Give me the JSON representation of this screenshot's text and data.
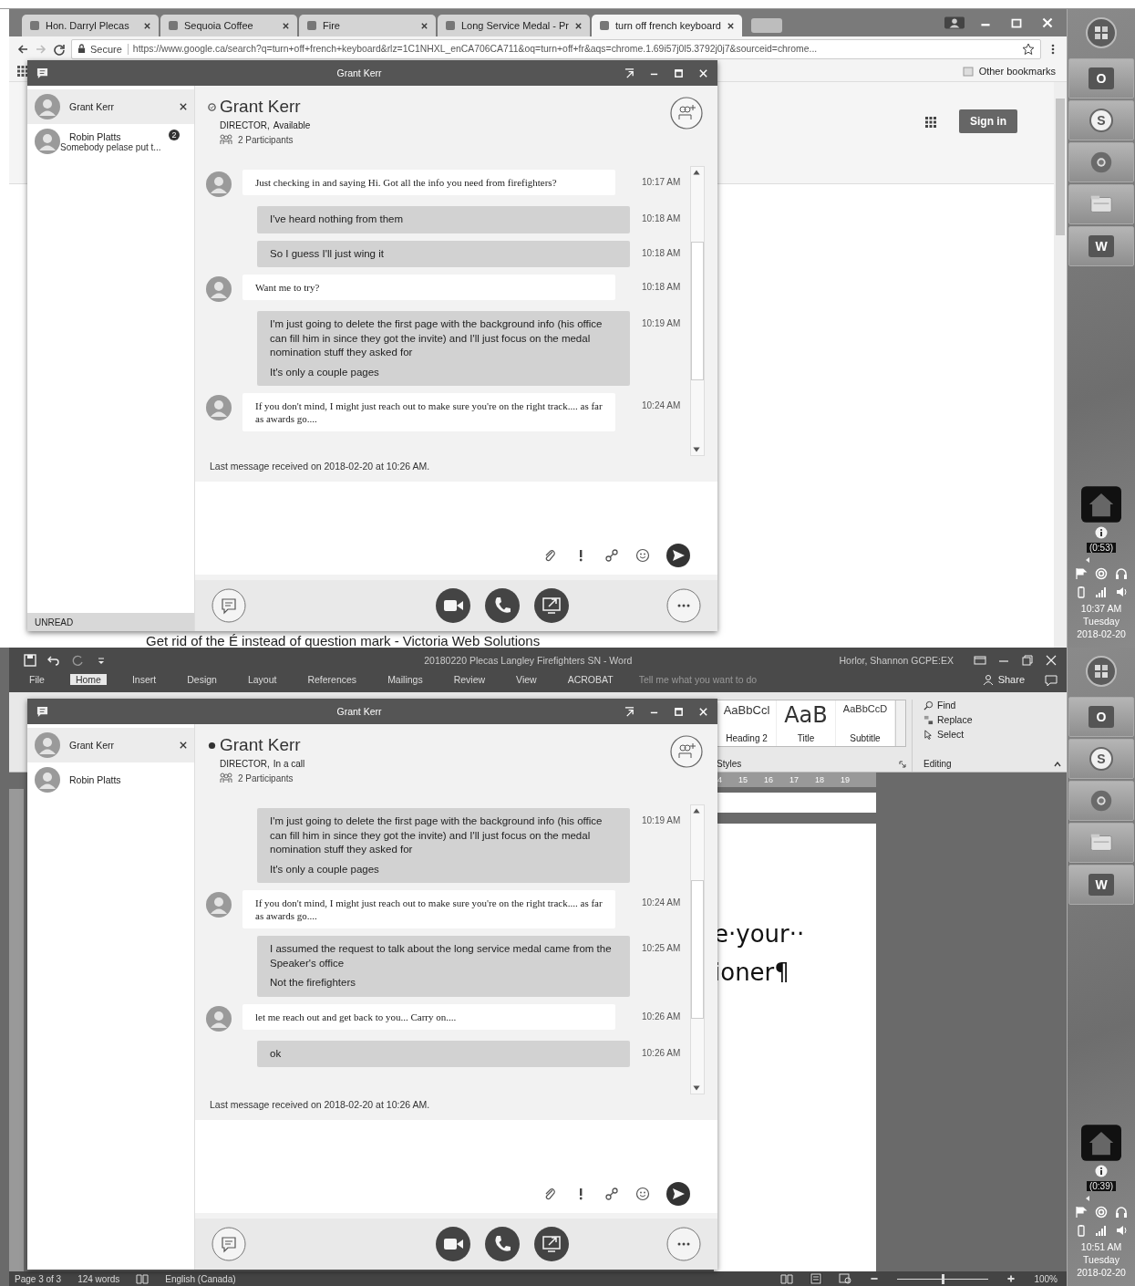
{
  "panels": [
    {
      "kind": "browser",
      "tabs": [
        {
          "label": "Hon. Darryl Plecas",
          "selected": false
        },
        {
          "label": "Sequoia Coffee",
          "selected": false
        },
        {
          "label": "Fire",
          "selected": false
        },
        {
          "label": "Long Service Medal - Pr",
          "selected": false
        },
        {
          "label": "turn off french keyboard",
          "selected": true
        }
      ],
      "address": {
        "secure": "Secure",
        "url": "https://www.google.ca/search?q=turn+off+french+keyboard&rlz=1C1NHXL_enCA706CA711&oq=turn+off+fr&aqs=chrome.1.69i57j0l5.3792j0j7&sourceid=chrome..."
      },
      "bookmark": "Other bookmarks",
      "sign_in": "Sign in",
      "result_title": "Get rid of the É instead of question mark - Victoria Web Solutions",
      "chat": {
        "title": "Grant Kerr",
        "conversations": [
          {
            "name": "Grant Kerr",
            "selected": true
          },
          {
            "name": "Robin Platts",
            "preview": "Somebody pelase put t...",
            "badge": "2",
            "selected": false
          }
        ],
        "unread_label": "UNREAD",
        "header": {
          "name": "Grant Kerr",
          "available": true,
          "role": "DIRECTOR,",
          "status": "Available",
          "participants": "2 Participants"
        },
        "messages": [
          {
            "kind": "them",
            "paragraphs": [
              "Just checking in and saying Hi. Got all the info you need from firefighters?"
            ],
            "time": "10:17 AM"
          },
          {
            "kind": "me",
            "paragraphs": [
              "I've heard nothing from them"
            ],
            "time": "10:18 AM"
          },
          {
            "kind": "me",
            "paragraphs": [
              "So I guess I'll just wing it"
            ],
            "time": "10:18 AM"
          },
          {
            "kind": "them",
            "paragraphs": [
              "Want me to try?"
            ],
            "time": "10:18 AM"
          },
          {
            "kind": "me",
            "paragraphs": [
              "I'm just going to delete the first page with the background info (his office can fill him in since they got the invite) and I'll just focus on the medal nomination stuff they asked for",
              "It's only a couple pages"
            ],
            "time": "10:19 AM"
          },
          {
            "kind": "them",
            "paragraphs": [
              "If you don't mind, I might just reach out to make sure you're on the right track.... as far as awards go...."
            ],
            "time": "10:24 AM"
          }
        ],
        "footer": "Last message received on 2018-02-20 at 10:26 AM."
      },
      "taskbar": {
        "apps": [
          {
            "kind": "mail",
            "letter": "O"
          },
          {
            "kind": "chat",
            "letter": "S"
          },
          {
            "kind": "browser"
          },
          {
            "kind": "files"
          },
          {
            "kind": "doc",
            "letter": "W"
          }
        ],
        "timer": "(0:53)",
        "time": "10:37 AM",
        "day": "Tuesday",
        "date": "2018-02-20"
      }
    },
    {
      "kind": "word",
      "title": "20180220 Plecas Langley Firefighters SN  -  Word",
      "account": "Horlor, Shannon GCPE:EX",
      "ribbon_tabs": [
        {
          "label": "File",
          "selected": false
        },
        {
          "label": "Home",
          "selected": true
        },
        {
          "label": "Insert",
          "selected": false
        },
        {
          "label": "Design",
          "selected": false
        },
        {
          "label": "Layout",
          "selected": false
        },
        {
          "label": "References",
          "selected": false
        },
        {
          "label": "Mailings",
          "selected": false
        },
        {
          "label": "Review",
          "selected": false
        },
        {
          "label": "View",
          "selected": false
        },
        {
          "label": "ACROBAT",
          "selected": false
        }
      ],
      "tell_me": "Tell me what you want to do",
      "share": "Share",
      "styles": [
        {
          "preview": "AaBbCcl",
          "name": "Heading 2",
          "kind": "heading"
        },
        {
          "preview": "AaB",
          "name": "Title",
          "kind": "title"
        },
        {
          "preview": "AaBbCcD",
          "name": "Subtitle",
          "kind": "subtitle"
        }
      ],
      "styles_label": "Styles",
      "editing": [
        "Find",
        "Replace",
        "Select"
      ],
      "editing_label": "Editing",
      "ruler": [
        "4",
        "15",
        "16",
        "17",
        "18",
        "19"
      ],
      "document_lines": [
        "e·your··",
        "ioner¶"
      ],
      "status": {
        "page": "Page 3 of 3",
        "words": "124 words",
        "language": "English (Canada)",
        "zoom": "100%"
      },
      "zoom_slider": {
        "level": 0.5
      },
      "chat": {
        "title": "Grant Kerr",
        "conversations": [
          {
            "name": "Grant Kerr",
            "selected": true
          },
          {
            "name": "Robin Platts",
            "selected": false
          }
        ],
        "header": {
          "name": "Grant Kerr",
          "available": false,
          "role": "DIRECTOR,",
          "status": "In a call",
          "participants": "2 Participants"
        },
        "messages": [
          {
            "kind": "me",
            "paragraphs": [
              "I'm just going to delete the first page with the background info (his office can fill him in since they got the invite) and I'll just focus on the medal nomination stuff they asked for",
              "It's only a couple pages"
            ],
            "time": "10:19 AM"
          },
          {
            "kind": "them",
            "paragraphs": [
              "If you don't mind, I might just reach out to make sure you're on the right track.... as far as awards go...."
            ],
            "time": "10:24 AM"
          },
          {
            "kind": "me",
            "paragraphs": [
              "I assumed the request to talk about the long service medal came from the Speaker's office",
              "Not the firefighters"
            ],
            "time": "10:25 AM"
          },
          {
            "kind": "them",
            "paragraphs": [
              "let me reach out and get back to you... Carry on...."
            ],
            "time": "10:26 AM"
          },
          {
            "kind": "me",
            "paragraphs": [
              "ok"
            ],
            "time": "10:26 AM"
          }
        ],
        "footer": "Last message received on 2018-02-20 at 10:26 AM."
      },
      "taskbar": {
        "apps": [
          {
            "kind": "mail",
            "letter": "O"
          },
          {
            "kind": "chat",
            "letter": "S"
          },
          {
            "kind": "browser"
          },
          {
            "kind": "files"
          },
          {
            "kind": "doc",
            "letter": "W"
          }
        ],
        "timer": "(0:39)",
        "time": "10:51 AM",
        "day": "Tuesday",
        "date": "2018-02-20"
      }
    }
  ]
}
